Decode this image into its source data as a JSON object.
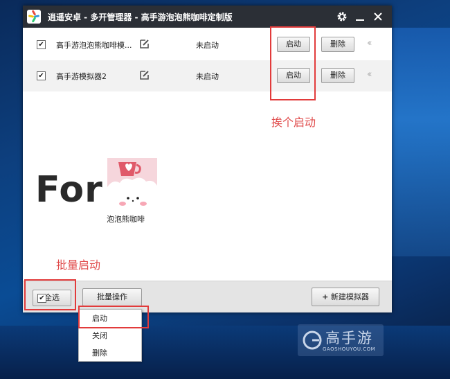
{
  "window": {
    "title": "逍遥安卓 - 多开管理器 - 高手游泡泡熊咖啡定制版",
    "settings_icon": "gear-icon",
    "minimize_icon": "minimize-icon",
    "close_icon": "close-icon"
  },
  "emulators": [
    {
      "checked": true,
      "name": "高手游泡泡熊咖啡模...",
      "status": "未启动",
      "start_label": "启动",
      "delete_label": "删除",
      "collapse_icon": "double-chevron-left-icon"
    },
    {
      "checked": true,
      "name": "高手游模拟器2",
      "status": "未启动",
      "start_label": "启动",
      "delete_label": "删除",
      "collapse_icon": "double-chevron-left-icon"
    }
  ],
  "annotations": {
    "start_each": "挨个启动",
    "batch_start": "批量启动"
  },
  "brand": {
    "big_text": "For",
    "caption": "泡泡熊咖啡"
  },
  "footer": {
    "select_all_label": "全选",
    "select_all_checked": true,
    "batch_label": "批量操作",
    "new_label": "新建模拟器",
    "new_icon": "plus-icon"
  },
  "batch_menu": {
    "items": [
      "启动",
      "关闭",
      "删除"
    ]
  },
  "watermark": {
    "text": "高手游",
    "url": "GAOSHOUYOU.COM"
  },
  "colors": {
    "titlebar": "#2b2f36",
    "annotation": "#e04b4b",
    "highlight_box": "#e23b3b"
  }
}
